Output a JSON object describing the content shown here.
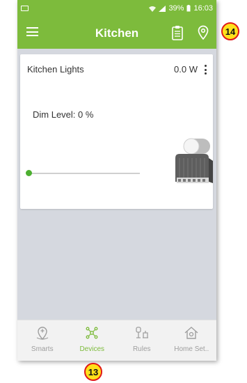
{
  "status_bar": {
    "right_text": "39%",
    "time": "16:03"
  },
  "app_bar": {
    "title": "Kitchen",
    "menu_icon": "hamburger-icon",
    "clipboard_icon": "clipboard-icon",
    "location_icon": "location-pin-icon"
  },
  "device": {
    "name": "Kitchen Lights",
    "power": "0.0 W",
    "dim_label": "Dim Level: 0  %",
    "dim_level_percent": 0,
    "image_icon": "dimmer-module-image"
  },
  "bottom_nav": {
    "items": [
      {
        "label": "Smarts",
        "icon": "smarts-icon",
        "active": false
      },
      {
        "label": "Devices",
        "icon": "devices-icon",
        "active": true
      },
      {
        "label": "Rules",
        "icon": "rules-icon",
        "active": false
      },
      {
        "label": "Home Set..",
        "icon": "home-settings-icon",
        "active": false
      }
    ]
  },
  "callouts": {
    "top": "14",
    "bottom": "13"
  },
  "colors": {
    "accent": "#7dbb3c",
    "slider": "#4caf30",
    "background": "#d5d8df",
    "callout_fill": "#ffe11a",
    "callout_border": "#e01818"
  }
}
